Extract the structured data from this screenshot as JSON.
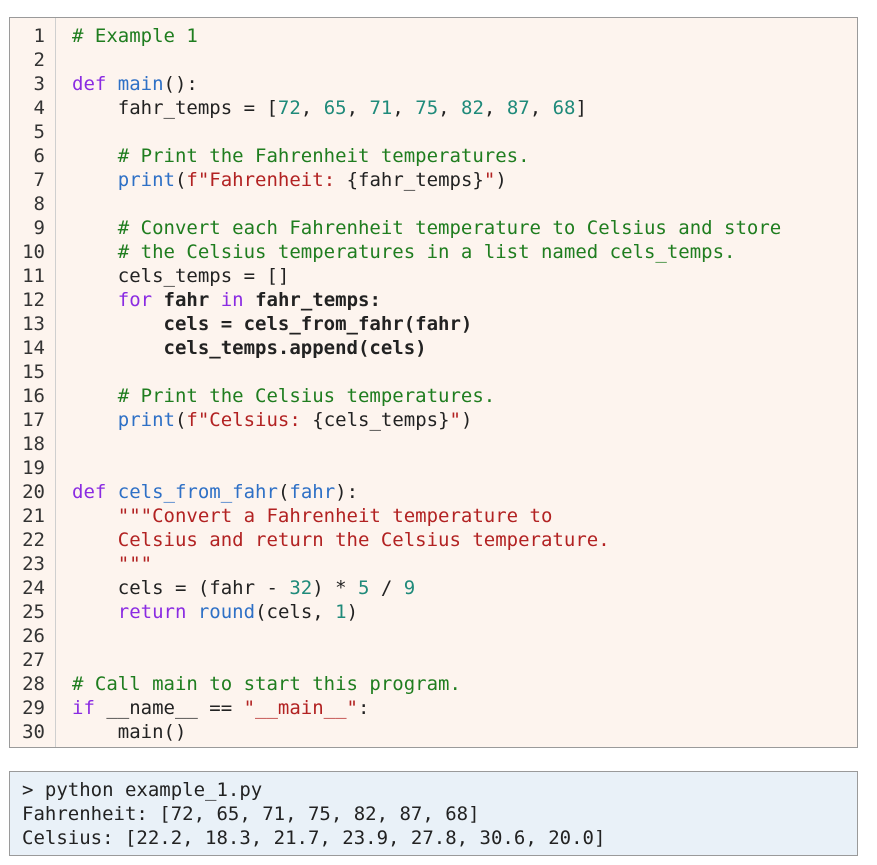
{
  "code_listing": {
    "lines": [
      {
        "n": "1",
        "tokens": [
          {
            "t": "# Example 1",
            "k": "comment"
          }
        ]
      },
      {
        "n": "2",
        "tokens": []
      },
      {
        "n": "3",
        "tokens": [
          {
            "t": "def",
            "k": "keyword"
          },
          {
            "t": " ",
            "k": "plain"
          },
          {
            "t": "main",
            "k": "builtin"
          },
          {
            "t": "():",
            "k": "plain"
          }
        ]
      },
      {
        "n": "4",
        "tokens": [
          {
            "t": "    fahr_temps = [",
            "k": "plain"
          },
          {
            "t": "72",
            "k": "number"
          },
          {
            "t": ", ",
            "k": "plain"
          },
          {
            "t": "65",
            "k": "number"
          },
          {
            "t": ", ",
            "k": "plain"
          },
          {
            "t": "71",
            "k": "number"
          },
          {
            "t": ", ",
            "k": "plain"
          },
          {
            "t": "75",
            "k": "number"
          },
          {
            "t": ", ",
            "k": "plain"
          },
          {
            "t": "82",
            "k": "number"
          },
          {
            "t": ", ",
            "k": "plain"
          },
          {
            "t": "87",
            "k": "number"
          },
          {
            "t": ", ",
            "k": "plain"
          },
          {
            "t": "68",
            "k": "number"
          },
          {
            "t": "]",
            "k": "plain"
          }
        ]
      },
      {
        "n": "5",
        "tokens": []
      },
      {
        "n": "6",
        "tokens": [
          {
            "t": "    # Print the Fahrenheit temperatures.",
            "k": "comment"
          }
        ]
      },
      {
        "n": "7",
        "tokens": [
          {
            "t": "    ",
            "k": "plain"
          },
          {
            "t": "print",
            "k": "builtin"
          },
          {
            "t": "(",
            "k": "plain"
          },
          {
            "t": "f\"Fahrenheit: ",
            "k": "string"
          },
          {
            "t": "{fahr_temps}",
            "k": "plain"
          },
          {
            "t": "\"",
            "k": "string"
          },
          {
            "t": ")",
            "k": "plain"
          }
        ]
      },
      {
        "n": "8",
        "tokens": []
      },
      {
        "n": "9",
        "tokens": [
          {
            "t": "    # Convert each Fahrenheit temperature to Celsius and store",
            "k": "comment"
          }
        ]
      },
      {
        "n": "10",
        "tokens": [
          {
            "t": "    # the Celsius temperatures in a list named cels_temps.",
            "k": "comment"
          }
        ]
      },
      {
        "n": "11",
        "tokens": [
          {
            "t": "    cels_temps = []",
            "k": "plain"
          }
        ]
      },
      {
        "n": "12",
        "tokens": [
          {
            "t": "    ",
            "k": "plain"
          },
          {
            "t": "for",
            "k": "keyword"
          },
          {
            "t": " fahr ",
            "k": "bold"
          },
          {
            "t": "in",
            "k": "keyword"
          },
          {
            "t": " fahr_temps:",
            "k": "bold"
          }
        ]
      },
      {
        "n": "13",
        "tokens": [
          {
            "t": "        cels = cels_from_fahr(fahr)",
            "k": "bold"
          }
        ]
      },
      {
        "n": "14",
        "tokens": [
          {
            "t": "        cels_temps.append(cels)",
            "k": "bold"
          }
        ]
      },
      {
        "n": "15",
        "tokens": []
      },
      {
        "n": "16",
        "tokens": [
          {
            "t": "    # Print the Celsius temperatures.",
            "k": "comment"
          }
        ]
      },
      {
        "n": "17",
        "tokens": [
          {
            "t": "    ",
            "k": "plain"
          },
          {
            "t": "print",
            "k": "builtin"
          },
          {
            "t": "(",
            "k": "plain"
          },
          {
            "t": "f\"Celsius: ",
            "k": "string"
          },
          {
            "t": "{cels_temps}",
            "k": "plain"
          },
          {
            "t": "\"",
            "k": "string"
          },
          {
            "t": ")",
            "k": "plain"
          }
        ]
      },
      {
        "n": "18",
        "tokens": []
      },
      {
        "n": "19",
        "tokens": []
      },
      {
        "n": "20",
        "tokens": [
          {
            "t": "def",
            "k": "keyword"
          },
          {
            "t": " ",
            "k": "plain"
          },
          {
            "t": "cels_from_fahr",
            "k": "builtin"
          },
          {
            "t": "(",
            "k": "plain"
          },
          {
            "t": "fahr",
            "k": "builtin"
          },
          {
            "t": "):",
            "k": "plain"
          }
        ]
      },
      {
        "n": "21",
        "tokens": [
          {
            "t": "    \"\"\"Convert a Fahrenheit temperature to",
            "k": "string"
          }
        ]
      },
      {
        "n": "22",
        "tokens": [
          {
            "t": "    Celsius and return the Celsius temperature.",
            "k": "string"
          }
        ]
      },
      {
        "n": "23",
        "tokens": [
          {
            "t": "    \"\"\"",
            "k": "string"
          }
        ]
      },
      {
        "n": "24",
        "tokens": [
          {
            "t": "    cels = (fahr - ",
            "k": "plain"
          },
          {
            "t": "32",
            "k": "number"
          },
          {
            "t": ") * ",
            "k": "plain"
          },
          {
            "t": "5",
            "k": "number"
          },
          {
            "t": " / ",
            "k": "plain"
          },
          {
            "t": "9",
            "k": "number"
          }
        ]
      },
      {
        "n": "25",
        "tokens": [
          {
            "t": "    ",
            "k": "plain"
          },
          {
            "t": "return",
            "k": "keyword"
          },
          {
            "t": " ",
            "k": "plain"
          },
          {
            "t": "round",
            "k": "builtin"
          },
          {
            "t": "(cels, ",
            "k": "plain"
          },
          {
            "t": "1",
            "k": "number"
          },
          {
            "t": ")",
            "k": "plain"
          }
        ]
      },
      {
        "n": "26",
        "tokens": []
      },
      {
        "n": "27",
        "tokens": []
      },
      {
        "n": "28",
        "tokens": [
          {
            "t": "# Call main to start this program.",
            "k": "comment"
          }
        ]
      },
      {
        "n": "29",
        "tokens": [
          {
            "t": "if",
            "k": "keyword"
          },
          {
            "t": " __name__ == ",
            "k": "plain"
          },
          {
            "t": "\"__main__\"",
            "k": "string"
          },
          {
            "t": ":",
            "k": "plain"
          }
        ]
      },
      {
        "n": "30",
        "tokens": [
          {
            "t": "    main()",
            "k": "plain"
          }
        ]
      }
    ]
  },
  "terminal": {
    "lines": [
      "> python example_1.py",
      "Fahrenheit: [72, 65, 71, 75, 82, 87, 68]",
      "Celsius: [22.2, 18.3, 21.7, 23.9, 27.8, 30.6, 20.0]"
    ]
  }
}
